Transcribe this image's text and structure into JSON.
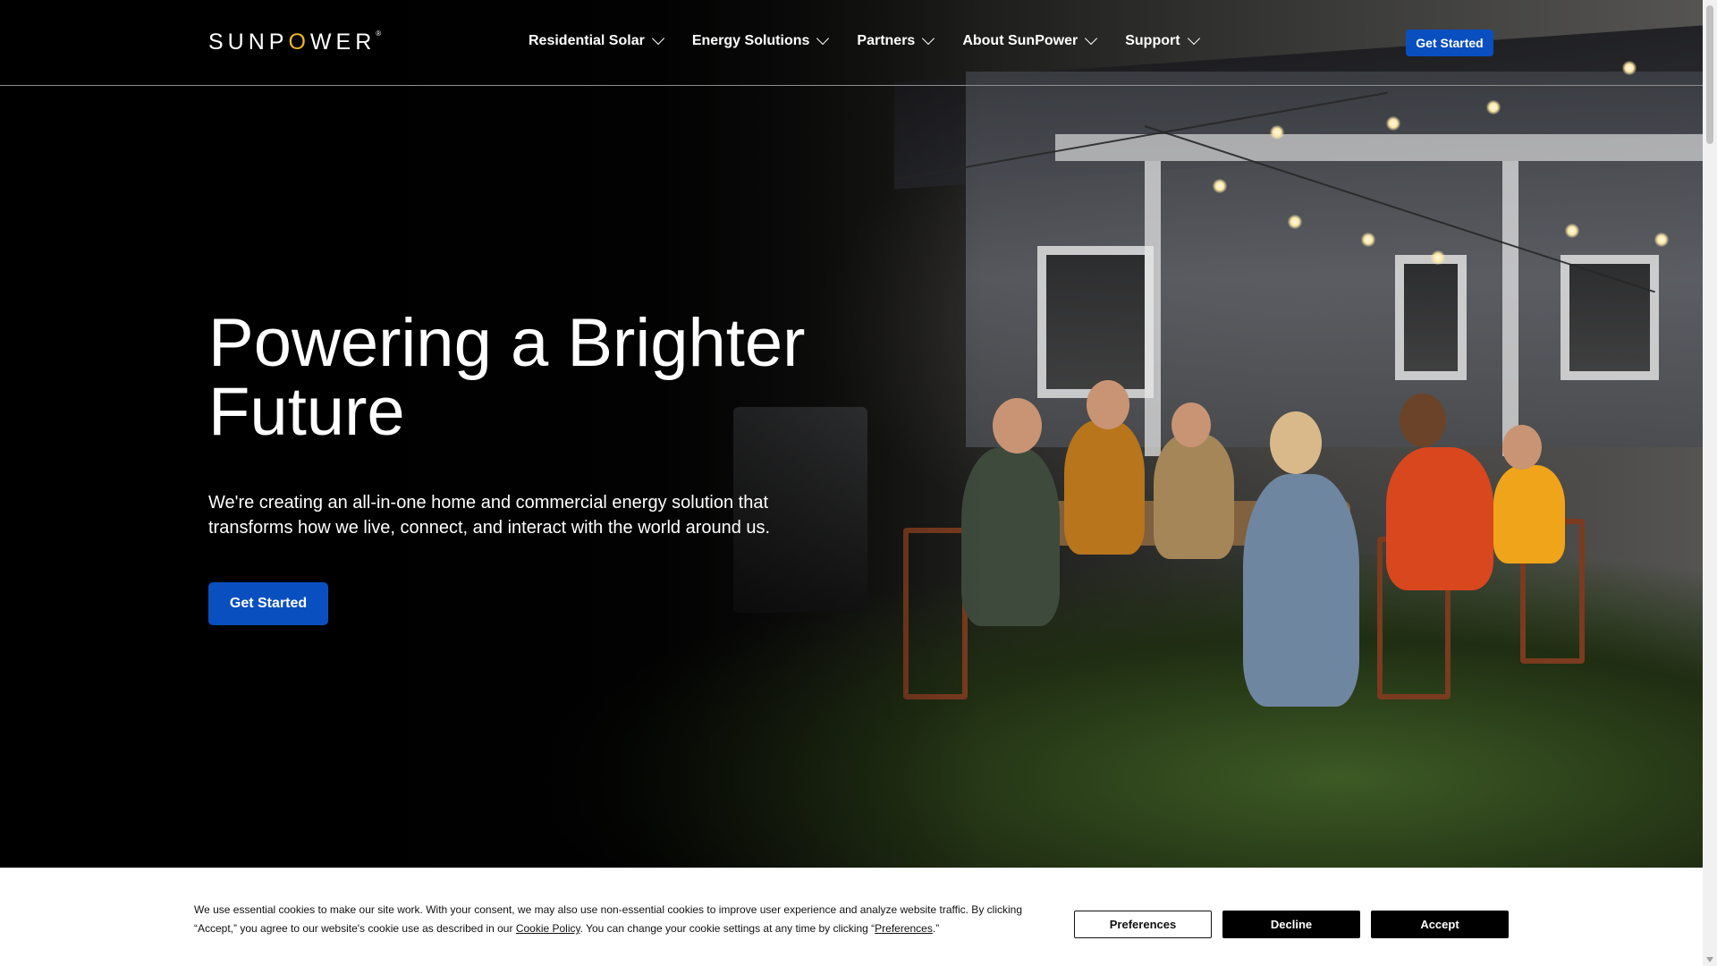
{
  "nav": {
    "logo_pre": "SUNP",
    "logo_o": "O",
    "logo_post": "WER",
    "logo_mark": "®",
    "items": [
      {
        "label": "Residential Solar"
      },
      {
        "label": "Energy Solutions"
      },
      {
        "label": "Partners"
      },
      {
        "label": "About SunPower"
      },
      {
        "label": "Support"
      }
    ],
    "cta_label": "Get Started"
  },
  "hero": {
    "title": "Powering a Brighter Future",
    "subtitle": "We're creating an all-in-one home and commercial energy solution that transforms how we live, connect, and interact with the world around us.",
    "cta_label": "Get Started"
  },
  "cookie": {
    "text_part1": "We use essential cookies to make our site work. With your consent, we may also use non-essential cookies to improve user experience and analyze website traffic. By clicking “Accept,” you agree to our website's cookie use as described in our ",
    "policy_link": "Cookie Policy",
    "text_part2": ". You can change your cookie settings at any time by clicking “",
    "prefs_link": "Preferences",
    "text_part3": ".”",
    "preferences_label": "Preferences",
    "decline_label": "Decline",
    "accept_label": "Accept"
  },
  "colors": {
    "brand_blue": "#0a4fbf",
    "logo_accent": "#f0b429",
    "nav_background": "#000000"
  }
}
